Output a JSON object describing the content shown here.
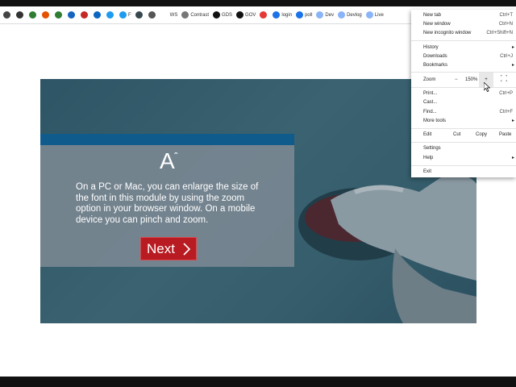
{
  "bookmarks": [
    {
      "icon": "bookmark-icon-1",
      "text": "",
      "color": "#444444"
    },
    {
      "icon": "bookmark-icon-2",
      "text": "",
      "color": "#333333"
    },
    {
      "icon": "bookmark-icon-3",
      "text": "",
      "color": "#2e7d32"
    },
    {
      "icon": "bookmark-icon-4",
      "text": "",
      "color": "#e65100"
    },
    {
      "icon": "bookmark-icon-5",
      "text": "",
      "color": "#2e7d32"
    },
    {
      "icon": "bookmark-icon-6",
      "text": "",
      "color": "#1565c0"
    },
    {
      "icon": "bookmark-icon-7",
      "text": "",
      "color": "#c62828"
    },
    {
      "icon": "linkedin-icon",
      "text": "",
      "color": "#0a66c2"
    },
    {
      "icon": "twitter-icon",
      "text": "",
      "color": "#1d9bf0"
    },
    {
      "icon": "twitter-icon-2",
      "text": "F",
      "color": "#1d9bf0"
    },
    {
      "icon": "bookmark-icon-8",
      "text": "",
      "color": "#37474f"
    },
    {
      "icon": "bookmark-icon-9",
      "text": "",
      "color": "#555555"
    },
    {
      "icon": "ws-icon",
      "text": "WS",
      "color": "#ffffff"
    },
    {
      "icon": "contrast-icon",
      "text": "Contrast",
      "color": "#777777"
    },
    {
      "icon": "gds-icon",
      "text": "GDS",
      "color": "#111111"
    },
    {
      "icon": "gov-icon",
      "text": "GOV",
      "color": "#111111"
    },
    {
      "icon": "youtube-icon",
      "text": "",
      "color": "#e53935"
    },
    {
      "icon": "login-icon",
      "text": "login",
      "color": "#1a73e8"
    },
    {
      "icon": "poll-icon",
      "text": "poll",
      "color": "#1a73e8"
    },
    {
      "icon": "dev-icon",
      "text": "Dev",
      "color": "#8ab4f8"
    },
    {
      "icon": "devlog-icon",
      "text": "Devlog",
      "color": "#8ab4f8"
    },
    {
      "icon": "live-icon",
      "text": "Live",
      "color": "#8ab4f8"
    }
  ],
  "module": {
    "font_icon": "A",
    "text": "On a PC or Mac, you can enlarge the size of the font in this module by using the zoom option in your browser window. On a mobile device you can pinch and zoom.",
    "next_label": "Next",
    "colors": {
      "header": "#0e5b8c",
      "button": "#b81c22"
    }
  },
  "menu": {
    "new_tab": {
      "label": "New tab",
      "shortcut": "Ctrl+T"
    },
    "new_window": {
      "label": "New window",
      "shortcut": "Ctrl+N"
    },
    "new_incognito": {
      "label": "New incognito window",
      "shortcut": "Ctrl+Shift+N"
    },
    "history": {
      "label": "History",
      "arrow": "▸"
    },
    "downloads": {
      "label": "Downloads",
      "shortcut": "Ctrl+J"
    },
    "bookmarks": {
      "label": "Bookmarks",
      "arrow": "▸"
    },
    "zoom": {
      "label": "Zoom",
      "minus": "−",
      "value": "150%",
      "plus": "+"
    },
    "print": {
      "label": "Print...",
      "shortcut": "Ctrl+P"
    },
    "cast": {
      "label": "Cast..."
    },
    "find": {
      "label": "Find...",
      "shortcut": "Ctrl+F"
    },
    "more_tools": {
      "label": "More tools",
      "arrow": "▸"
    },
    "edit": {
      "label": "Edit",
      "cut": "Cut",
      "copy": "Copy",
      "paste": "Paste"
    },
    "settings": {
      "label": "Settings"
    },
    "help": {
      "label": "Help",
      "arrow": "▸"
    },
    "exit": {
      "label": "Exit"
    }
  }
}
